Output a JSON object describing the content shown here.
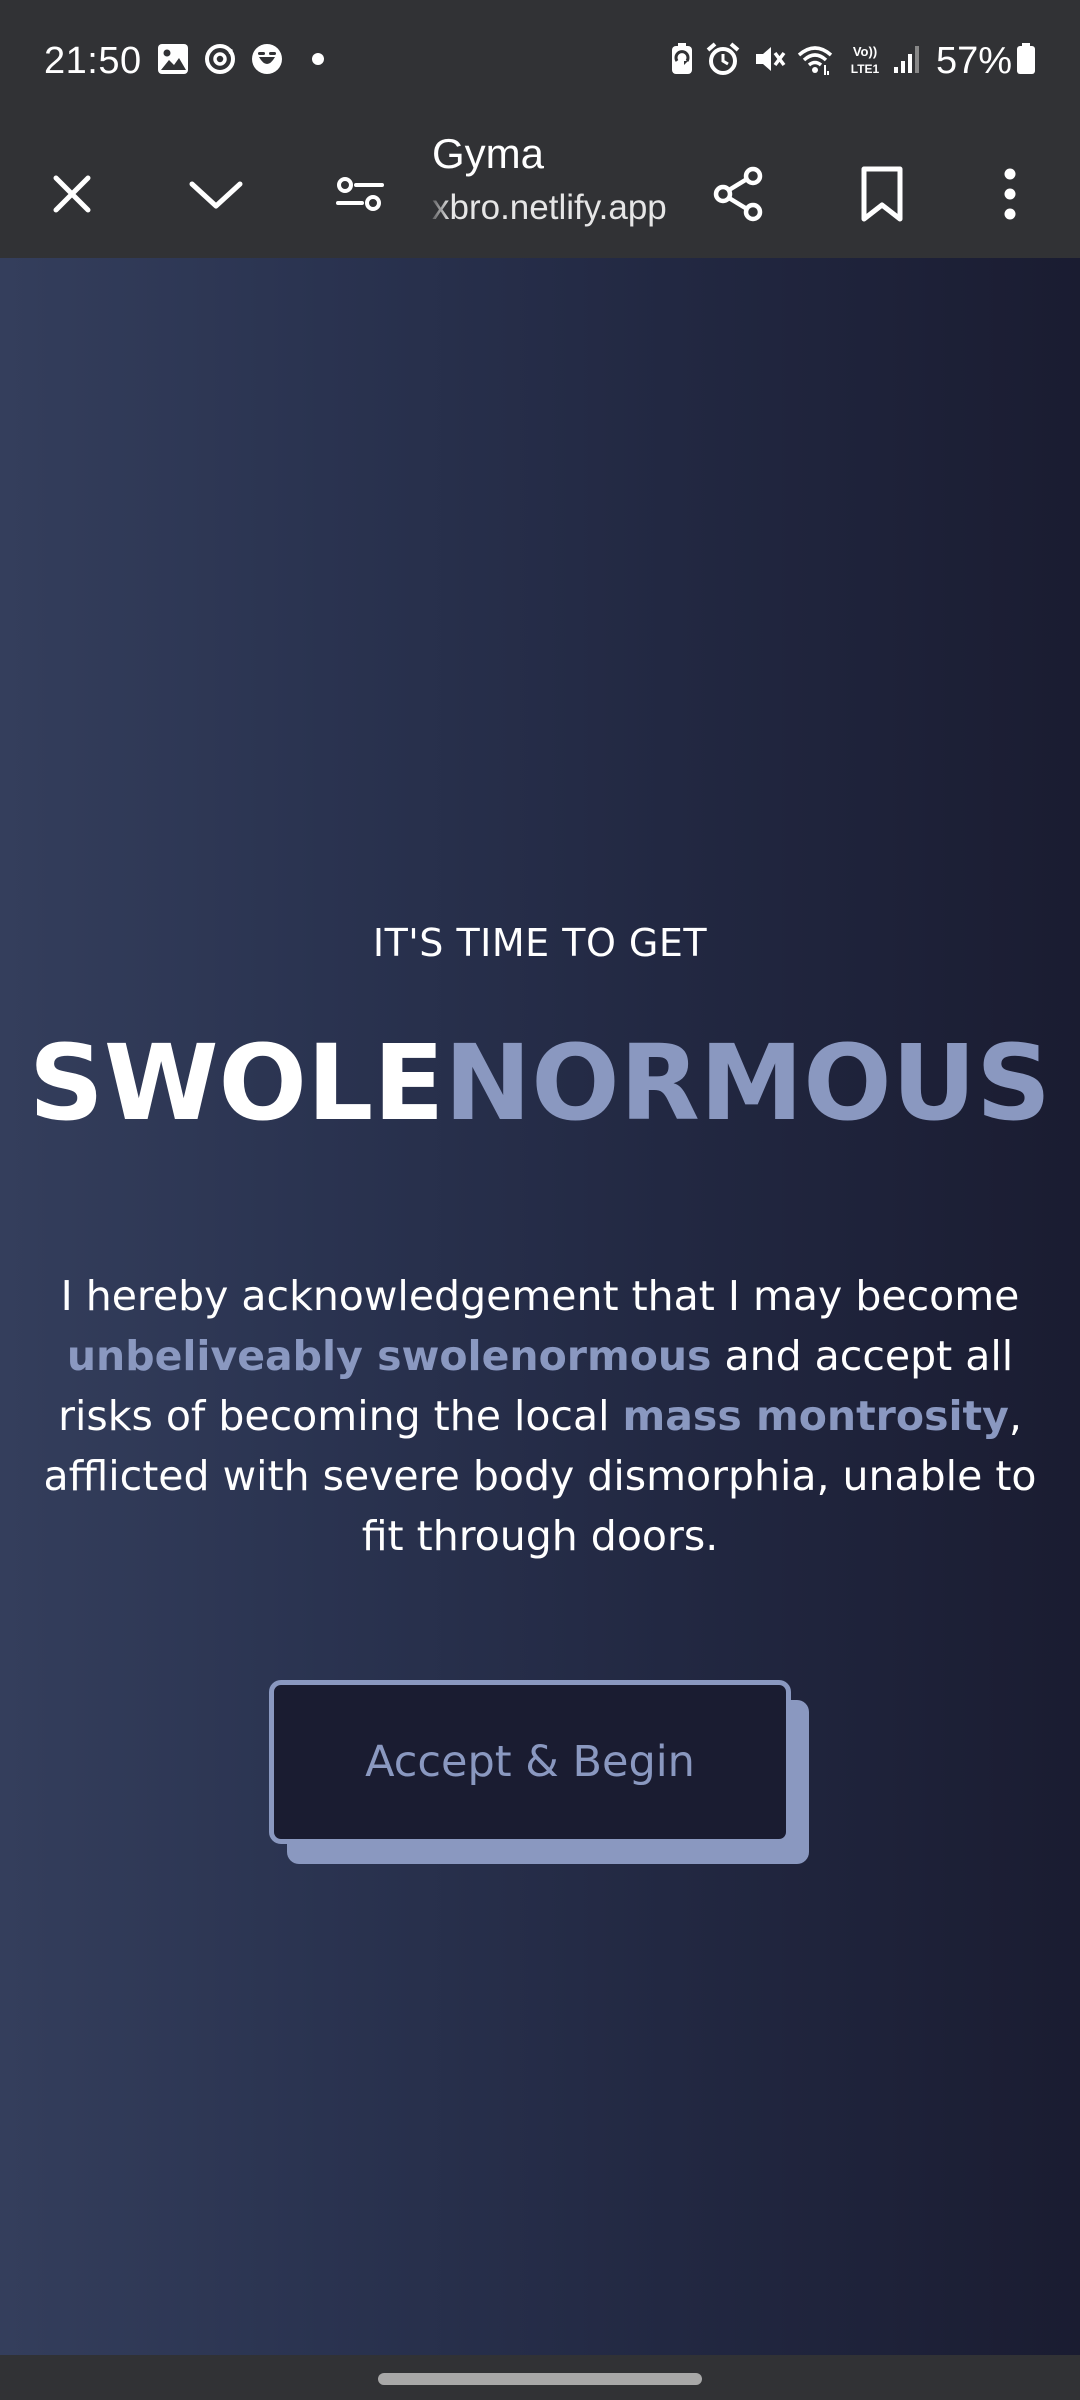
{
  "status_bar": {
    "time": "21:50",
    "battery_percent": "57%",
    "left_icons": [
      "gallery-icon",
      "sync-icon",
      "face-icon",
      "dot-icon"
    ],
    "right_icons": [
      "battery-saver-icon",
      "alarm-icon",
      "mute-icon",
      "wifi-icon",
      "volte-icon",
      "signal-icon",
      "battery-icon"
    ]
  },
  "browser_bar": {
    "title": "Gyma",
    "url": "xbro.netlify.app",
    "buttons": [
      "close-icon",
      "chevron-down-icon",
      "site-settings-icon",
      "share-icon",
      "bookmark-icon",
      "more-vert-icon"
    ]
  },
  "hero": {
    "eyebrow": "IT'S TIME TO GET",
    "headline_part1": "SWOLE",
    "headline_part2": "NORMOUS",
    "paragraph": {
      "t1": "I hereby acknowledgement that I may become ",
      "h1": "unbeliveably swolenormous",
      "t2": " and accept all risks of becoming the local ",
      "h2": "mass montrosity",
      "t3": ", afflicted with severe body dismorphia, unable to fit through doors."
    },
    "cta_label": "Accept & Begin"
  },
  "colors": {
    "chrome": "#313235",
    "page_gradient_left": "#343e5c",
    "page_gradient_right": "#1a1c31",
    "accent": "#8a98c0",
    "button_fill": "#1a1c31",
    "text": "#ffffff"
  }
}
